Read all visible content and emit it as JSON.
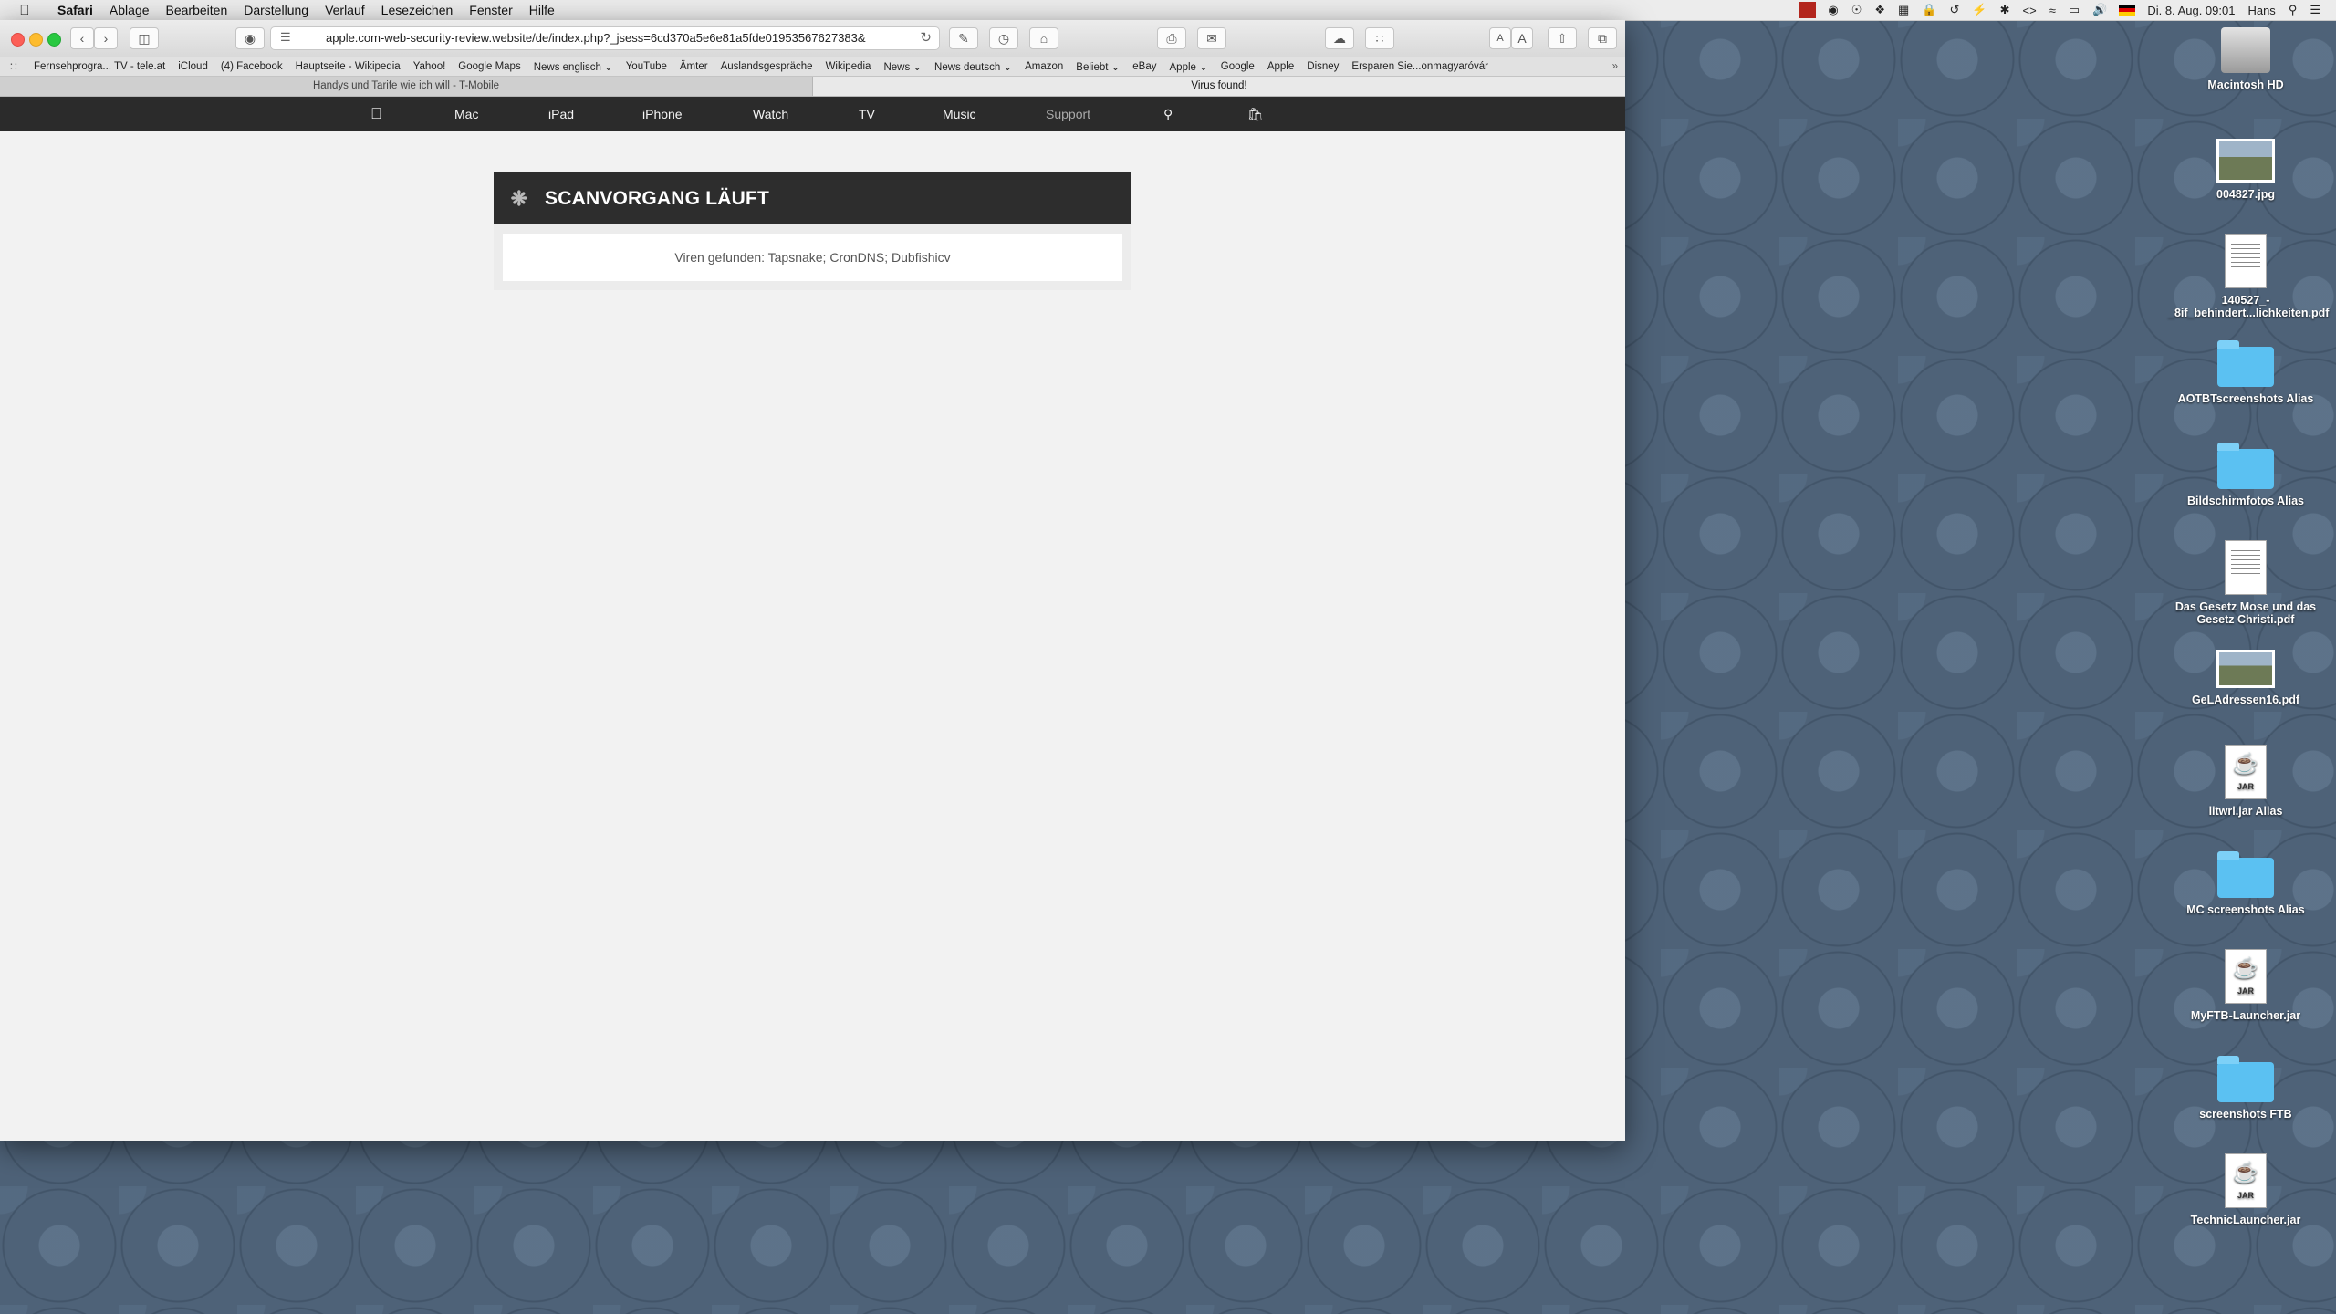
{
  "menubar": {
    "app": "Safari",
    "items": [
      "Ablage",
      "Bearbeiten",
      "Darstellung",
      "Verlauf",
      "Lesezeichen",
      "Fenster",
      "Hilfe"
    ],
    "datetime": "Di. 8. Aug.  09:01",
    "user": "Hans"
  },
  "browser": {
    "url": "apple.com-web-security-review.website/de/index.php?_jsess=6cd370a5e6e81a5fde01953567627383&",
    "bookmarks": [
      "Fernsehprogra... TV - tele.at",
      "iCloud",
      "(4) Facebook",
      "Hauptseite - Wikipedia",
      "Yahoo!",
      "Google Maps",
      "News englisch ⌄",
      "YouTube",
      "Ämter",
      "Auslandsgespräche",
      "Wikipedia",
      "News ⌄",
      "News deutsch ⌄",
      "Amazon",
      "Beliebt ⌄",
      "eBay",
      "Apple ⌄",
      "Google",
      "Apple",
      "Disney",
      "Ersparen Sie...onmagyaróvár"
    ],
    "tabs": [
      {
        "title": "Handys und Tarife wie ich will - T-Mobile",
        "active": false
      },
      {
        "title": "Virus found!",
        "active": true
      }
    ]
  },
  "apple_nav": {
    "items": [
      "Mac",
      "iPad",
      "iPhone",
      "Watch",
      "TV",
      "Music",
      "Support"
    ]
  },
  "scan": {
    "title": "SCANVORGANG LÄUFT",
    "result": "Viren gefunden: Tapsnake; CronDNS; Dubfishicv"
  },
  "desktop": {
    "icons": [
      {
        "label": "Macintosh HD",
        "kind": "hd"
      },
      {
        "label": "004827.jpg",
        "kind": "photo"
      },
      {
        "label": "140527_-_8if_behindert...lichkeiten.pdf",
        "kind": "doc"
      },
      {
        "label": "AOTBTscreenshots Alias",
        "kind": "folder"
      },
      {
        "label": "Bildschirmfotos Alias",
        "kind": "folder"
      },
      {
        "label": "Das Gesetz Mose und das Gesetz Christi.pdf",
        "kind": "doc"
      },
      {
        "label": "GeLAdressen16.pdf",
        "kind": "doc"
      },
      {
        "label": "litwrl.jar Alias",
        "kind": "jar"
      },
      {
        "label": "MC screenshots Alias",
        "kind": "folder"
      },
      {
        "label": "MyFTB-Launcher.jar",
        "kind": "jar"
      },
      {
        "label": "screenshots FTB",
        "kind": "folder"
      },
      {
        "label": "TechnicLauncher.jar",
        "kind": "jar"
      }
    ],
    "jar_label": "JAR"
  }
}
